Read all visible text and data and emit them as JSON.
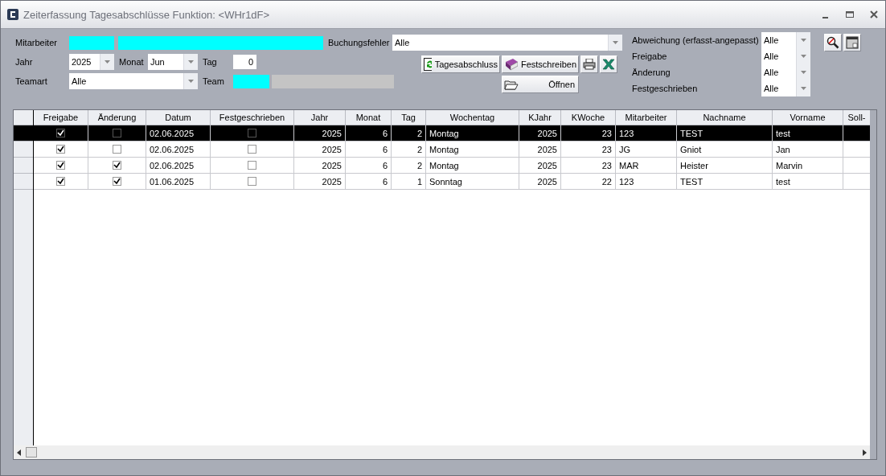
{
  "window": {
    "title": "Zeiterfassung Tagesabschlüsse Funktion: <WHr1dF>"
  },
  "filters": {
    "mitarbeiter": {
      "label": "Mitarbeiter"
    },
    "buchungsfehler": {
      "label": "Buchungsfehler",
      "value": "Alle"
    },
    "jahr": {
      "label": "Jahr",
      "value": "2025"
    },
    "monat": {
      "label": "Monat",
      "value": "Jun"
    },
    "tag": {
      "label": "Tag",
      "value": "0"
    },
    "teamart": {
      "label": "Teamart",
      "value": "Alle"
    },
    "team": {
      "label": "Team"
    }
  },
  "buttons": [
    {
      "kind": "refresh",
      "label": "Tagesabschluss"
    },
    {
      "kind": "book",
      "label": "Festschreiben"
    },
    {
      "kind": "print"
    },
    {
      "kind": "excel"
    },
    {
      "kind": "folder",
      "label": "Öffnen"
    }
  ],
  "right_filters": [
    {
      "label": "Abweichung (erfasst-angepasst)",
      "value": "Alle"
    },
    {
      "label": "Freigabe",
      "value": "Alle"
    },
    {
      "label": "Änderung",
      "value": "Alle"
    },
    {
      "label": "Festgeschrieben",
      "value": "Alle"
    }
  ],
  "table": {
    "columns": [
      {
        "label": "Freigabe",
        "kind": "check"
      },
      {
        "label": "Änderung",
        "kind": "check"
      },
      {
        "label": "Datum",
        "kind": "text"
      },
      {
        "label": "Festgeschrieben",
        "kind": "check"
      },
      {
        "label": "Jahr",
        "kind": "number"
      },
      {
        "label": "Monat",
        "kind": "number"
      },
      {
        "label": "Tag",
        "kind": "number"
      },
      {
        "label": "Wochentag",
        "kind": "text"
      },
      {
        "label": "KJahr",
        "kind": "number"
      },
      {
        "label": "KWoche",
        "kind": "number"
      },
      {
        "label": "Mitarbeiter",
        "kind": "text"
      },
      {
        "label": "Nachname",
        "kind": "text"
      },
      {
        "label": "Vorname",
        "kind": "text"
      },
      {
        "label": "Soll-",
        "kind": "text"
      }
    ],
    "rows": [
      {
        "selected": true,
        "cells": [
          {
            "checked": true
          },
          {
            "checked": false
          },
          "02.06.2025",
          {
            "checked": false
          },
          "2025",
          "6",
          "2",
          "Montag",
          "2025",
          "23",
          "123",
          "TEST",
          "test"
        ]
      },
      {
        "selected": false,
        "cells": [
          {
            "checked": true
          },
          {
            "checked": false
          },
          "02.06.2025",
          {
            "checked": false
          },
          "2025",
          "6",
          "2",
          "Montag",
          "2025",
          "23",
          "JG",
          "Gniot",
          "Jan"
        ]
      },
      {
        "selected": false,
        "cells": [
          {
            "checked": true
          },
          {
            "checked": true
          },
          "02.06.2025",
          {
            "checked": false
          },
          "2025",
          "6",
          "2",
          "Montag",
          "2025",
          "23",
          "MAR",
          "Heister",
          "Marvin"
        ]
      },
      {
        "selected": false,
        "cells": [
          {
            "checked": true
          },
          {
            "checked": true
          },
          "01.06.2025",
          {
            "checked": false
          },
          "2025",
          "6",
          "1",
          "Sonntag",
          "2025",
          "22",
          "123",
          "TEST",
          "test"
        ]
      }
    ]
  }
}
